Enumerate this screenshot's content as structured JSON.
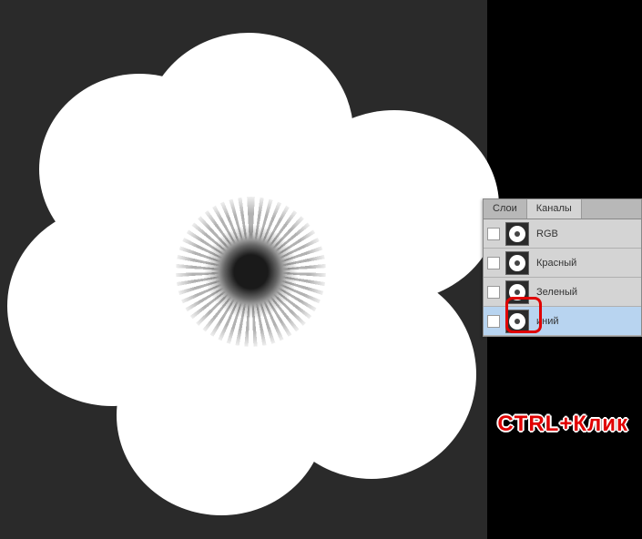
{
  "tabs": {
    "layers": "Слои",
    "channels": "Каналы"
  },
  "channels": {
    "rgb": "RGB",
    "red": "Красный",
    "green": "Зеленый",
    "blue": "иний"
  },
  "annotation": "CTRL+Клик"
}
